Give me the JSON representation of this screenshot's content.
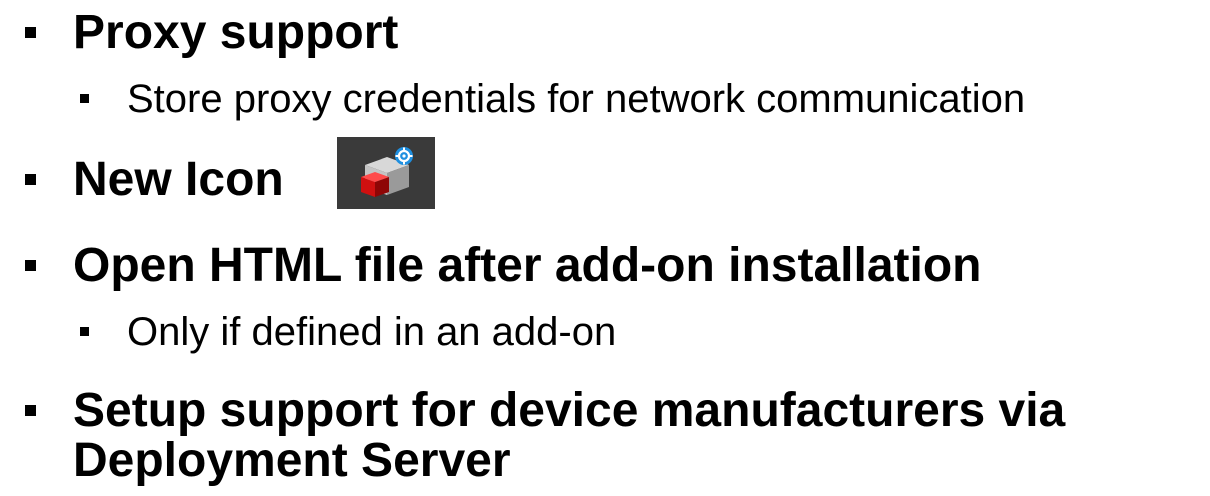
{
  "items": [
    {
      "label": "Proxy support",
      "children": [
        {
          "label": "Store proxy credentials for network communication"
        }
      ]
    },
    {
      "label": "New Icon",
      "icon": "addon-cube-gear-icon"
    },
    {
      "label": "Open HTML file after add-on installation",
      "children": [
        {
          "label": "Only if defined in an add-on"
        }
      ]
    },
    {
      "label_line1": "Setup support for device manufacturers via",
      "label_line2": "Deployment Server"
    }
  ]
}
